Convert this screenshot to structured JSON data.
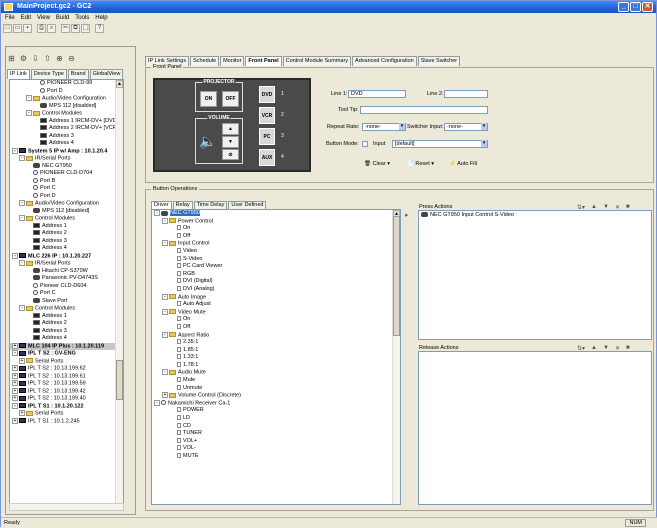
{
  "window": {
    "title": "MainProject.gc2 - GC2"
  },
  "menu": [
    "File",
    "Edit",
    "View",
    "Build",
    "Tools",
    "Help"
  ],
  "toolbar_icons": [
    "new-icon",
    "open-icon",
    "save-icon",
    "print-icon",
    "print-preview-icon",
    "cut-icon",
    "copy-icon",
    "paste-icon",
    "help-icon"
  ],
  "left_tabs": [
    "IP Link",
    "Device Type",
    "Brand",
    "GlobalView"
  ],
  "left_active_tab": "IP Link",
  "tree": [
    {
      "indent": 3,
      "icon": "port",
      "label": "PIONEER CLD-99"
    },
    {
      "indent": 3,
      "icon": "port",
      "label": "Port D"
    },
    {
      "indent": 2,
      "icon": "folder",
      "label": "Audio/Video Configuration",
      "exp": "-"
    },
    {
      "indent": 3,
      "icon": "proj",
      "label": "MPS 112 [disabled]"
    },
    {
      "indent": 2,
      "icon": "folder",
      "label": "Control Modules",
      "exp": "-"
    },
    {
      "indent": 3,
      "icon": "cm",
      "label": "Address 1 IRCM-DV+ [DVD]"
    },
    {
      "indent": 3,
      "icon": "cm",
      "label": "Address 2 IRCM-DV+ [VCR]"
    },
    {
      "indent": 3,
      "icon": "cm",
      "label": "Address 3"
    },
    {
      "indent": 3,
      "icon": "cm",
      "label": "Address 4"
    },
    {
      "indent": 0,
      "icon": "sys",
      "label": "System 5 IP w/ Amp : 10.1.20.4",
      "exp": "-",
      "bold": true
    },
    {
      "indent": 1,
      "icon": "folder",
      "label": "IR/Serial Ports",
      "exp": "-"
    },
    {
      "indent": 2,
      "icon": "proj",
      "label": "NEC GT950"
    },
    {
      "indent": 2,
      "icon": "port",
      "label": "PIONEER CLD-D704"
    },
    {
      "indent": 2,
      "icon": "port",
      "label": "Port B"
    },
    {
      "indent": 2,
      "icon": "port",
      "label": "Port C"
    },
    {
      "indent": 2,
      "icon": "port",
      "label": "Port D"
    },
    {
      "indent": 1,
      "icon": "folder",
      "label": "Audio/Video Configuration",
      "exp": "-"
    },
    {
      "indent": 2,
      "icon": "proj",
      "label": "MPS 112 [disabled]"
    },
    {
      "indent": 1,
      "icon": "folder",
      "label": "Control Modules",
      "exp": "-"
    },
    {
      "indent": 2,
      "icon": "cm",
      "label": "Address 1"
    },
    {
      "indent": 2,
      "icon": "cm",
      "label": "Address 2"
    },
    {
      "indent": 2,
      "icon": "cm",
      "label": "Address 3"
    },
    {
      "indent": 2,
      "icon": "cm",
      "label": "Address 4"
    },
    {
      "indent": 0,
      "icon": "sys",
      "label": "MLC 226 IP : 10.1.20.227",
      "exp": "-",
      "bold": true
    },
    {
      "indent": 1,
      "icon": "folder",
      "label": "IR/Serial Ports",
      "exp": "-"
    },
    {
      "indent": 2,
      "icon": "proj",
      "label": "Hitachi CP-S370W"
    },
    {
      "indent": 2,
      "icon": "proj",
      "label": "Panasonic PV-D4743S"
    },
    {
      "indent": 2,
      "icon": "port",
      "label": "Pioneer CLD-D604"
    },
    {
      "indent": 2,
      "icon": "port",
      "label": "Port C"
    },
    {
      "indent": 2,
      "icon": "proj",
      "label": "Slave Port"
    },
    {
      "indent": 1,
      "icon": "folder",
      "label": "Control Modules",
      "exp": "-"
    },
    {
      "indent": 2,
      "icon": "cm",
      "label": "Address 1"
    },
    {
      "indent": 2,
      "icon": "cm",
      "label": "Address 2"
    },
    {
      "indent": 2,
      "icon": "cm",
      "label": "Address 3"
    },
    {
      "indent": 2,
      "icon": "cm",
      "label": "Address 4"
    },
    {
      "indent": 0,
      "icon": "sys",
      "label": "MLC 104 IP Plus : 10.1.20.119",
      "exp": "+",
      "bold": true,
      "sel": true
    },
    {
      "indent": 0,
      "icon": "sys",
      "label": "IPL T S2 : GV-ENG",
      "exp": "-",
      "bold": true
    },
    {
      "indent": 1,
      "icon": "folder",
      "label": "Serial Ports",
      "exp": "+"
    },
    {
      "indent": 0,
      "icon": "sys",
      "label": "IPL T S2 : 10.13.199.62",
      "exp": "+"
    },
    {
      "indent": 0,
      "icon": "sys",
      "label": "IPL T S2 : 10.13.199.61",
      "exp": "+"
    },
    {
      "indent": 0,
      "icon": "sys",
      "label": "IPL T S2 : 10.13.199.59",
      "exp": "+"
    },
    {
      "indent": 0,
      "icon": "sys",
      "label": "IPL T S2 : 10.13.199.42",
      "exp": "+"
    },
    {
      "indent": 0,
      "icon": "sys",
      "label": "IPL T S2 : 10.13.199.40",
      "exp": "+"
    },
    {
      "indent": 0,
      "icon": "sys",
      "label": "IPL T S1 : 10.1.20.122",
      "exp": "-",
      "bold": true
    },
    {
      "indent": 1,
      "icon": "folder",
      "label": "Serial Ports",
      "exp": "+"
    },
    {
      "indent": 0,
      "icon": "sys",
      "label": "IPL T S1 : 10.1.2.245",
      "exp": "+"
    }
  ],
  "main_tabs": [
    "IP Link Settings",
    "Schedule",
    "Monitor",
    "Front Panel",
    "Control Module Summary",
    "Advanced Configuration",
    "Slave Switcher"
  ],
  "main_active_tab": "Front Panel",
  "front_panel": {
    "legend": "Front Panel",
    "projector_label": "PROJECTOR",
    "on_label": "ON",
    "off_label": "OFF",
    "volume_label": "VOLUME",
    "side_buttons": [
      {
        "label": "DVD",
        "num": "1"
      },
      {
        "label": "VCR",
        "num": "2"
      },
      {
        "label": "PC",
        "num": "3"
      },
      {
        "label": "AUX",
        "num": "4"
      }
    ],
    "line1_label": "Line 1:",
    "line1_value": "DVD",
    "line2_label": "Line 2:",
    "line2_value": "",
    "tooltip_label": "Tool Tip:",
    "tooltip_value": "",
    "repeat_label": "Repeat Rate:",
    "repeat_value": "-none-",
    "switcher_label": "Switcher Input:",
    "switcher_value": "-none-",
    "button_mode_label": "Button Mode:",
    "button_mode_a": "Input",
    "button_mode_b": "[default]",
    "clear_label": "Clear",
    "reset_label": "Reset",
    "autofill_label": "Auto Fill"
  },
  "button_ops": {
    "legend": "Button Operations",
    "tabs": [
      "Driver",
      "Relay",
      "Time Delay",
      "User Defined"
    ],
    "active_tab": "Driver",
    "tree": [
      {
        "indent": 0,
        "type": "device",
        "label": "NEC GT950",
        "sel": true,
        "exp": "-"
      },
      {
        "indent": 1,
        "type": "folder",
        "label": "Power Control",
        "exp": "-"
      },
      {
        "indent": 2,
        "type": "doc",
        "label": "On"
      },
      {
        "indent": 2,
        "type": "doc",
        "label": "Off"
      },
      {
        "indent": 1,
        "type": "folder",
        "label": "Input Control",
        "exp": "-"
      },
      {
        "indent": 2,
        "type": "doc",
        "label": "Video"
      },
      {
        "indent": 2,
        "type": "doc",
        "label": "S-Video"
      },
      {
        "indent": 2,
        "type": "doc",
        "label": "PC Card Viewer"
      },
      {
        "indent": 2,
        "type": "doc",
        "label": "RGB"
      },
      {
        "indent": 2,
        "type": "doc",
        "label": "DVI (Digital)"
      },
      {
        "indent": 2,
        "type": "doc",
        "label": "DVI (Analog)"
      },
      {
        "indent": 1,
        "type": "folder",
        "label": "Auto Image",
        "exp": "-"
      },
      {
        "indent": 2,
        "type": "doc",
        "label": "Auto Adjust"
      },
      {
        "indent": 1,
        "type": "folder",
        "label": "Video Mute",
        "exp": "-"
      },
      {
        "indent": 2,
        "type": "doc",
        "label": "On"
      },
      {
        "indent": 2,
        "type": "doc",
        "label": "Off"
      },
      {
        "indent": 1,
        "type": "folder",
        "label": "Aspect Ratio",
        "exp": "-"
      },
      {
        "indent": 2,
        "type": "doc",
        "label": "2.35:1"
      },
      {
        "indent": 2,
        "type": "doc",
        "label": "1.85:1"
      },
      {
        "indent": 2,
        "type": "doc",
        "label": "1.33:1"
      },
      {
        "indent": 2,
        "type": "doc",
        "label": "1.78:1"
      },
      {
        "indent": 1,
        "type": "folder",
        "label": "Audio Mute",
        "exp": "-"
      },
      {
        "indent": 2,
        "type": "doc",
        "label": "Mute"
      },
      {
        "indent": 2,
        "type": "doc",
        "label": "Unmute"
      },
      {
        "indent": 1,
        "type": "folder",
        "label": "Volume Control (Discrete)",
        "exp": "+"
      },
      {
        "indent": 0,
        "type": "port",
        "label": "Nakamichi Receiver Ca-1",
        "exp": "-"
      },
      {
        "indent": 2,
        "type": "doc",
        "label": "POWER"
      },
      {
        "indent": 2,
        "type": "doc",
        "label": "LD"
      },
      {
        "indent": 2,
        "type": "doc",
        "label": "CD"
      },
      {
        "indent": 2,
        "type": "doc",
        "label": "TUNER"
      },
      {
        "indent": 2,
        "type": "doc",
        "label": "VOL+"
      },
      {
        "indent": 2,
        "type": "doc",
        "label": "VOL-"
      },
      {
        "indent": 2,
        "type": "doc",
        "label": "MUTE"
      }
    ],
    "press_label": "Press Actions",
    "press_items": [
      "NEC GT950 Input Control S-Video"
    ],
    "release_label": "Release Actions"
  },
  "status": {
    "left": "Ready",
    "right": "NUM"
  }
}
